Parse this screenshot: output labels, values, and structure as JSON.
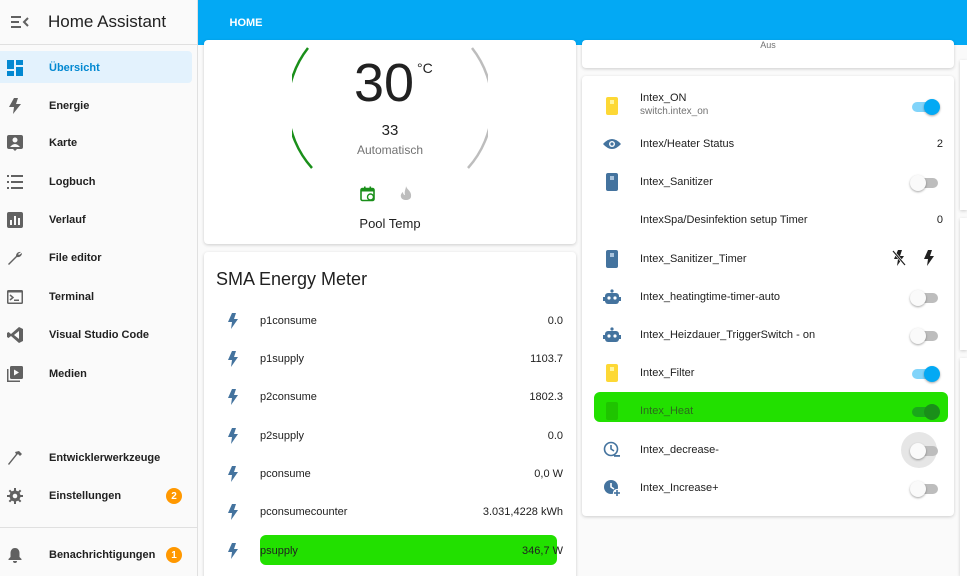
{
  "app": {
    "title": "Home Assistant"
  },
  "sidebar": {
    "items": [
      {
        "label": "Übersicht",
        "icon": "dashboard-icon"
      },
      {
        "label": "Energie",
        "icon": "lightning-icon"
      },
      {
        "label": "Karte",
        "icon": "map-account-icon"
      },
      {
        "label": "Logbuch",
        "icon": "list-icon"
      },
      {
        "label": "Verlauf",
        "icon": "chart-bar-icon"
      },
      {
        "label": "File editor",
        "icon": "wrench-icon"
      },
      {
        "label": "Terminal",
        "icon": "console-icon"
      },
      {
        "label": "Visual Studio Code",
        "icon": "vscode-icon"
      },
      {
        "label": "Medien",
        "icon": "play-box-icon"
      }
    ],
    "bottom": [
      {
        "label": "Entwicklerwerkzeuge",
        "icon": "hammer-icon"
      },
      {
        "label": "Einstellungen",
        "icon": "gear-icon",
        "badge": "2"
      },
      {
        "label": "Benachrichtigungen",
        "icon": "bell-icon",
        "badge": "1"
      }
    ]
  },
  "topbar": {
    "tab": "HOME",
    "color": "#03a9f4"
  },
  "thermostat": {
    "current": "30",
    "unit": "°C",
    "target": "33",
    "mode": "Automatisch",
    "name": "Pool Temp"
  },
  "stub_card": {
    "state": "Aus"
  },
  "sma": {
    "title": "SMA Energy Meter",
    "rows": [
      {
        "label": "p1consume",
        "value": "0.0"
      },
      {
        "label": "p1supply",
        "value": "1103.7"
      },
      {
        "label": "p2consume",
        "value": "1802.3"
      },
      {
        "label": "p2supply",
        "value": "0.0"
      },
      {
        "label": "pconsume",
        "value": "0,0 W"
      },
      {
        "label": "pconsumecounter",
        "value": "3.031,4228 kWh"
      },
      {
        "label": "psupply",
        "value": "346,7 W"
      }
    ]
  },
  "intex": {
    "rows": [
      {
        "label": "Intex_ON",
        "sub": "switch.intex_on",
        "type": "toggle",
        "state": "on"
      },
      {
        "label": "Intex/Heater Status",
        "type": "value",
        "value": "2"
      },
      {
        "label": "Intex_Sanitizer",
        "type": "toggle",
        "state": "off"
      },
      {
        "label": "IntexSpa/Desinfektion setup Timer",
        "type": "value",
        "value": "0"
      },
      {
        "label": "Intex_Sanitizer_Timer",
        "type": "buttons"
      },
      {
        "label": "Intex_heatingtime-timer-auto",
        "type": "toggle",
        "state": "off"
      },
      {
        "label": "Intex_Heizdauer_TriggerSwitch - on",
        "type": "toggle",
        "state": "off"
      },
      {
        "label": "Intex_Filter",
        "type": "toggle",
        "state": "on"
      },
      {
        "label": "Intex_Heat",
        "type": "toggle",
        "state": "on"
      },
      {
        "label": "Intex_decrease-",
        "type": "toggle",
        "state": "off"
      },
      {
        "label": "Intex_Increase+",
        "type": "toggle",
        "state": "off"
      }
    ]
  },
  "colors": {
    "accent": "#03a9f4",
    "icon_blue": "#44739e",
    "switch_yellow": "#fdd835",
    "badge_orange": "#ff9800",
    "highlight_green": "#22e000",
    "dial_green": "#1a8f1a"
  }
}
